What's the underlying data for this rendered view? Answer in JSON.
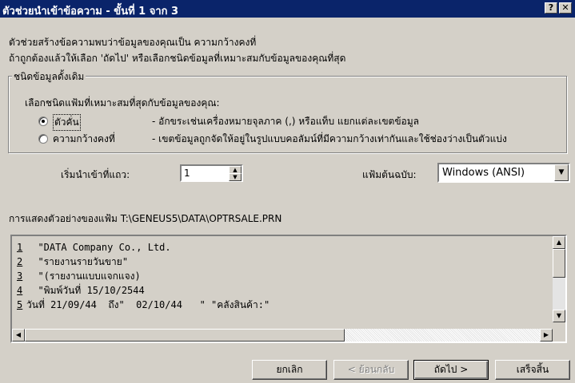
{
  "window": {
    "title": "ตัวช่วยนำเข้าข้อความ - ขั้นที่ 1 จาก 3",
    "help_label": "?",
    "close_label": "✕"
  },
  "intro": {
    "line1": "ตัวช่วยสร้างข้อความพบว่าข้อมูลของคุณเป็น ความกว้างคงที่",
    "line2": "ถ้าถูกต้องแล้วให้เลือก 'ถัดไป' หรือเลือกชนิดข้อมูลที่เหมาะสมกับข้อมูลของคุณที่สุด"
  },
  "original_type": {
    "legend": "ชนิดข้อมูลดั้งเดิม",
    "prompt": "เลือกชนิดแฟ้มที่เหมาะสมที่สุดกับข้อมูลของคุณ:",
    "options": [
      {
        "label": "ตัวคั่น",
        "desc": "- อักขระเช่นเครื่องหมายจุลภาค (,) หรือแท็บ แยกแต่ละเขตข้อมูล",
        "selected": true
      },
      {
        "label": "ความกว้างคงที่",
        "desc": "- เขตข้อมูลถูกจัดให้อยู่ในรูปแบบคอลัมน์ที่มีความกว้างเท่ากันและใช้ช่องว่างเป็นตัวแบ่ง",
        "selected": false
      }
    ]
  },
  "start_row": {
    "label": "เริ่มนำเข้าที่แถว:",
    "value": "1"
  },
  "file_origin": {
    "label": "แฟ้มต้นฉบับ:",
    "value": "Windows (ANSI)"
  },
  "preview": {
    "label": "การแสดงตัวอย่างของแฟ้ม T:\\GENEUS5\\DATA\\OPTRSALE.PRN",
    "lines": [
      {
        "num": "1",
        "text": "  \"DATA Company Co., Ltd."
      },
      {
        "num": "2",
        "text": "  \"รายงานรายวันขาย\""
      },
      {
        "num": "3",
        "text": "  \"(รายงานแบบแจกแจง)"
      },
      {
        "num": "4",
        "text": "  \"พิมพ์วันที่ 15/10/2544"
      },
      {
        "num": "5",
        "text": "วันที่ 21/09/44  ถึง\"  02/10/44   \" \"คลังสินค้า:\""
      }
    ]
  },
  "buttons": {
    "cancel": "ยกเลิก",
    "back": "< ย้อนกลับ",
    "next": "ถัดไป >",
    "finish": "เสร็จสิ้น"
  },
  "colors": {
    "titlebar": "#0a246a",
    "face": "#d4d0c8"
  }
}
